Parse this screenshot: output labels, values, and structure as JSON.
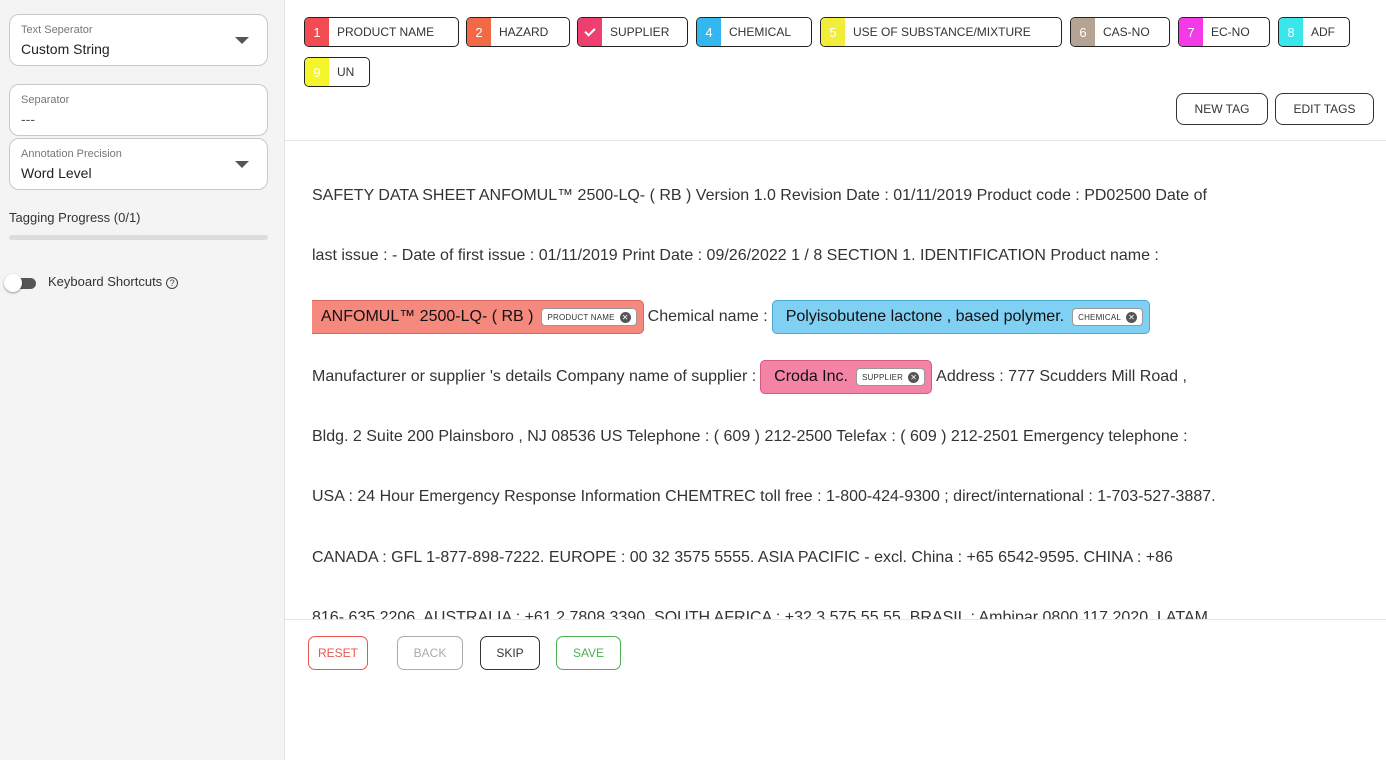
{
  "sidebar": {
    "text_separator": {
      "label": "Text Seperator",
      "value": "Custom String"
    },
    "separator": {
      "label": "Separator",
      "value": "---"
    },
    "precision": {
      "label": "Annotation Precision",
      "value": "Word Level"
    },
    "progress": {
      "label": "Tagging Progress (0/1)",
      "fraction": 0
    },
    "shortcuts": {
      "label": "Keyboard Shortcuts",
      "help": "?"
    }
  },
  "tags": [
    {
      "num": "1",
      "name": "PRODUCT NAME",
      "color": "#f24b52"
    },
    {
      "num": "2",
      "name": "HAZARD",
      "color": "#f26a45"
    },
    {
      "num": "",
      "name": "SUPPLIER",
      "color": "#ee3f6e",
      "checked": true
    },
    {
      "num": "4",
      "name": "CHEMICAL",
      "color": "#32b8ee"
    },
    {
      "num": "5",
      "name": "USE OF SUBSTANCE/MIXTURE",
      "color": "#f2ec3a"
    },
    {
      "num": "6",
      "name": "CAS-NO",
      "color": "#b5a394"
    },
    {
      "num": "7",
      "name": "EC-NO",
      "color": "#f33ae6"
    },
    {
      "num": "8",
      "name": "ADF",
      "color": "#38e6ec"
    },
    {
      "num": "9",
      "name": "UN",
      "color": "#f5f52c"
    }
  ],
  "toolbar": {
    "new_tag": "NEW TAG",
    "edit_tags": "EDIT TAGS"
  },
  "doc": {
    "l1": "SAFETY DATA SHEET ANFOMUL™ 2500-LQ- ( RB ) Version 1.0 Revision Date : 01/11/2019 Product code : PD02500 Date of",
    "l2": "last issue : - Date of first issue : 01/11/2019 Print Date : 09/26/2022 1 / 8 SECTION 1. IDENTIFICATION Product name :",
    "ann1": {
      "text": "ANFOMUL™ 2500-LQ- ( RB )",
      "tag": "PRODUCT NAME",
      "bg": "#f5897e",
      "border": "#d8665c"
    },
    "l3_mid": "Chemical name :",
    "ann2": {
      "text": "Polyisobutene lactone , based polymer.",
      "tag": "CHEMICAL",
      "bg": "#7fd0f2",
      "border": "#4aa9d3"
    },
    "l4_pre": "Manufacturer or supplier 's details Company name of supplier :",
    "ann3": {
      "text": "Croda Inc.",
      "tag": "SUPPLIER",
      "bg": "#f484a6",
      "border": "#d65b83"
    },
    "l4_post": "Address : 777 Scudders Mill Road ,",
    "l5": "Bldg. 2 Suite 200 Plainsboro , NJ 08536 US Telephone : ( 609 ) 212-2500 Telefax : ( 609 ) 212-2501 Emergency telephone :",
    "l6": "USA : 24 Hour Emergency Response Information CHEMTREC toll free : 1-800-424-9300 ; direct/international : 1-703-527-3887.",
    "l7": "CANADA : GFL 1-877-898-7222. EUROPE : 00 32 3575 5555. ASIA PACIFIC - excl. China : +65 6542-9595. CHINA : +86",
    "l8": "816- 635 2206. AUSTRALIA : +61 2 7808 3390. SOUTH AFRICA : +32 3 575 55 55. BRASIL : Ambipar 0800 117 2020. LATAM"
  },
  "actions": {
    "reset": "RESET",
    "back": "BACK",
    "skip": "SKIP",
    "save": "SAVE"
  },
  "colors": {
    "reset": "#e8574f",
    "back": "#aaaaaa",
    "skip": "#333333",
    "save": "#4caf50"
  }
}
